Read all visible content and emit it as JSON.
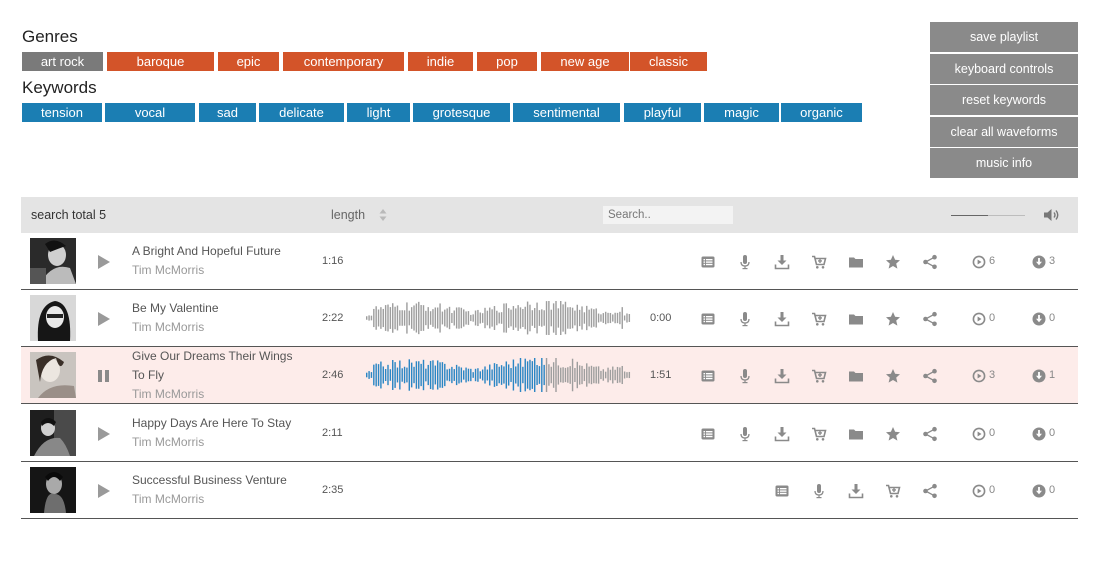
{
  "genres": {
    "title": "Genres",
    "tags": [
      {
        "label": "art rock",
        "color": "#7a7a7a"
      },
      {
        "label": "baroque",
        "color": "#d35429"
      },
      {
        "label": "epic",
        "color": "#d35429"
      },
      {
        "label": "contemporary",
        "color": "#d35429"
      },
      {
        "label": "indie",
        "color": "#d35429"
      },
      {
        "label": "pop",
        "color": "#d35429"
      },
      {
        "label": "new age",
        "color": "#d35429"
      },
      {
        "label": "classic",
        "color": "#d35429"
      }
    ]
  },
  "keywords": {
    "title": "Keywords",
    "tags": [
      {
        "label": "tension",
        "color": "#1b7eb3"
      },
      {
        "label": "vocal",
        "color": "#1b7eb3"
      },
      {
        "label": "sad",
        "color": "#1b7eb3"
      },
      {
        "label": "delicate",
        "color": "#1b7eb3"
      },
      {
        "label": "light",
        "color": "#1b7eb3"
      },
      {
        "label": "grotesque",
        "color": "#1b7eb3"
      },
      {
        "label": "sentimental",
        "color": "#1b7eb3"
      },
      {
        "label": "playful",
        "color": "#1b7eb3"
      },
      {
        "label": "magic",
        "color": "#1b7eb3"
      },
      {
        "label": "organic",
        "color": "#1b7eb3"
      }
    ]
  },
  "sidebar": {
    "buttons": [
      {
        "label": "save playlist"
      },
      {
        "label": "keyboard controls"
      },
      {
        "label": "reset keywords"
      },
      {
        "label": "clear all waveforms"
      },
      {
        "label": "music info"
      }
    ]
  },
  "search_bar": {
    "total_label": "search total 5",
    "length_label": "length",
    "search_placeholder": "Search..",
    "volume_level": 0.5
  },
  "colors": {
    "waveform_played": "#2b86c4",
    "waveform_unplayed": "#9e9e9e",
    "icon_gray": "#8a8a8a"
  },
  "tracks": [
    {
      "title": "A Bright And Hopeful Future",
      "artist": "Tim McMorris",
      "length": "1:16",
      "state": "stopped",
      "waveform": false,
      "progress_time": "",
      "progress": 0,
      "plays": "6",
      "downloads": "3",
      "has_folder": true,
      "has_star": true,
      "cover": "cover-1"
    },
    {
      "title": "Be My Valentine",
      "artist": "Tim McMorris",
      "length": "2:22",
      "state": "stopped",
      "waveform": true,
      "progress_time": "0:00",
      "progress": 0,
      "plays": "0",
      "downloads": "0",
      "has_folder": true,
      "has_star": true,
      "cover": "cover-2"
    },
    {
      "title": "Give Our Dreams Their Wings To Fly",
      "artist": "Tim McMorris",
      "length": "2:46",
      "state": "playing",
      "waveform": true,
      "progress_time": "1:51",
      "progress": 0.67,
      "plays": "3",
      "downloads": "1",
      "has_folder": true,
      "has_star": true,
      "cover": "cover-3"
    },
    {
      "title": "Happy Days Are Here To Stay",
      "artist": "Tim McMorris",
      "length": "2:11",
      "state": "stopped",
      "waveform": false,
      "progress_time": "",
      "progress": 0,
      "plays": "0",
      "downloads": "0",
      "has_folder": true,
      "has_star": true,
      "cover": "cover-4"
    },
    {
      "title": "Successful Business Venture",
      "artist": "Tim McMorris",
      "length": "2:35",
      "state": "stopped",
      "waveform": false,
      "progress_time": "",
      "progress": 0,
      "plays": "0",
      "downloads": "0",
      "has_folder": false,
      "has_star": false,
      "cover": "cover-5"
    }
  ]
}
